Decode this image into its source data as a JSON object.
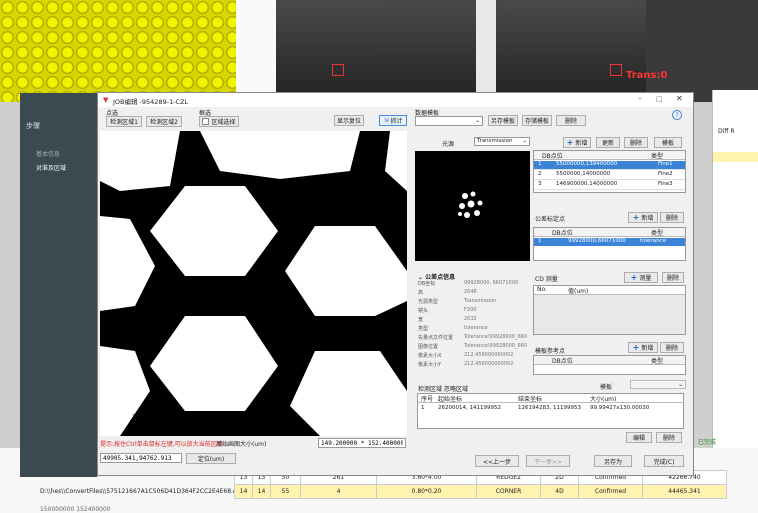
{
  "background": {
    "overlay_text": "Trans:0",
    "right_header": "Diff R",
    "bottom_left_text_1": "D:\\\\hes\\\\ConvertFiles\\\\575121667A1C506D41D364F2CC2E4E68.c",
    "bottom_left_text_2": "150000000  152400000",
    "rows": [
      [
        "13",
        "13",
        "50",
        "261",
        "3.60*4.00",
        "REDGE2",
        "2D",
        "Confirmed",
        "42266.740"
      ],
      [
        "14",
        "14",
        "55",
        "4",
        "0.80*0.20",
        "CORNER",
        "4D",
        "Confirmed",
        "44465.341"
      ]
    ]
  },
  "sidebar": {
    "title": "步骤",
    "items": [
      "基本信息",
      "对准及区域"
    ]
  },
  "window": {
    "title": "JOB编辑 -954289-1-CZL",
    "point_section": "点选",
    "btn_area1": "检测区域1",
    "btn_area2": "检测区域2",
    "box_section": "框选",
    "btn_region_select": "区域选择",
    "btn_show_reset": "显示复位",
    "btn_capture": "抓计",
    "hint": "提示:按住Ctrl单击鼠标左键,可以放大当前区域",
    "scale_bar": "20 μm",
    "coord_value": "49905.341,94762.913",
    "btn_locate": "定位(um)",
    "origin_size_label": "原始画图大小(um)",
    "origin_size_value": "149.200000 * 152.400000",
    "template_label": "数据模板",
    "btn_save_template": "另存模板",
    "btn_store_template": "存储模板",
    "btn_delete": "删除",
    "light_label": "光源",
    "light_value": "Transmission",
    "btn_add": "新增",
    "btn_update": "更新",
    "btn_template": "模板",
    "loc_table": {
      "headers": [
        "DB点位",
        "类型"
      ],
      "rows": [
        [
          "1",
          "55000000,139400000",
          "Fine1"
        ],
        [
          "2",
          "5500000,14000000",
          "Fine2"
        ],
        [
          "3",
          "146900000,14000000",
          "Fine3"
        ]
      ]
    },
    "tol_label": "公差标定点",
    "tol_table": {
      "headers": [
        "DB点位",
        "类型"
      ],
      "rows": [
        [
          "1",
          "99928000,66071000",
          "tolerance"
        ]
      ]
    },
    "info_title": "公差点信息",
    "info": [
      [
        "DB坐标",
        "99928000, 66071000"
      ],
      [
        "高",
        "2048"
      ],
      [
        "光源类型",
        "Transmission"
      ],
      [
        "镜头",
        "F200"
      ],
      [
        "宽",
        "2032"
      ],
      [
        "类型",
        "tolerance"
      ],
      [
        "矢量点文件位置",
        "Tolerance\\99928000_660"
      ],
      [
        "图像位置",
        "Tolerance\\99928000_660"
      ],
      [
        "像素大小X",
        "212.456000000002"
      ],
      [
        "像素大小Y",
        "212.456000000002"
      ]
    ],
    "cd_label": "CD 测量",
    "btn_measure": "测量",
    "cd_headers": [
      "No.",
      "值(um)"
    ],
    "ref_label": "模板参考点",
    "ref_headers": [
      "DB点位",
      "类型"
    ],
    "tabs": [
      "检测区域",
      "忽略区域"
    ],
    "template_small": "模板",
    "region_table": {
      "headers": [
        "序号",
        "起始坐标",
        "结束坐标",
        "大小(um)"
      ],
      "rows": [
        [
          "1",
          "26200014, 141199952",
          "126194283, 11199953",
          "99.99427x130.00030"
        ]
      ]
    },
    "btn_edit": "编辑",
    "btn_prev": "<<上一步",
    "btn_next": "下一步>>",
    "btn_saveas": "另存为",
    "btn_finish": "完成(C)",
    "status_ok": "已完成"
  }
}
